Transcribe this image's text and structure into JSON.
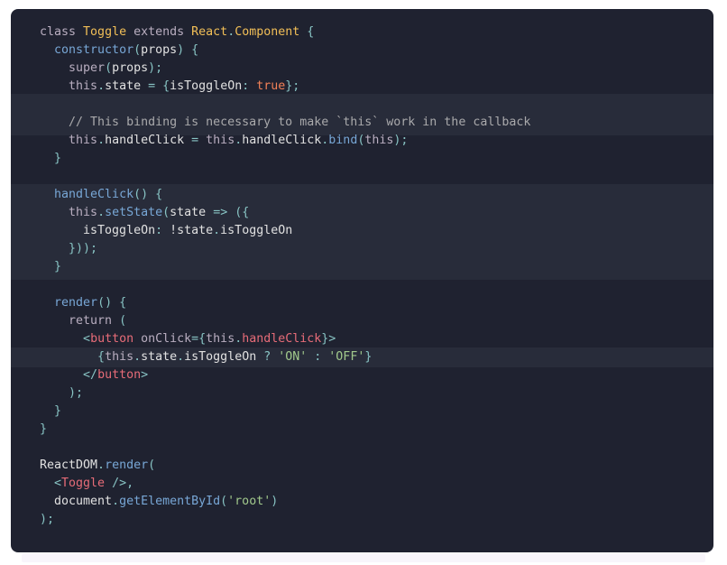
{
  "editor": {
    "highlight_band_1": [
      4,
      5
    ],
    "highlight_band_2": [
      9,
      13
    ],
    "highlight_line": 18,
    "lines": [
      [
        [
          "t-kw",
          "class "
        ],
        [
          "t-cls",
          "Toggle"
        ],
        [
          "t-kw",
          " extends "
        ],
        [
          "t-cls",
          "React"
        ],
        [
          "t-p",
          "."
        ],
        [
          "t-cls",
          "Component"
        ],
        [
          "t-p",
          " {"
        ]
      ],
      [
        [
          "t-txt",
          "  "
        ],
        [
          "t-fn",
          "constructor"
        ],
        [
          "t-p",
          "("
        ],
        [
          "t-txt",
          "props"
        ],
        [
          "t-p",
          ") {"
        ]
      ],
      [
        [
          "t-txt",
          "    "
        ],
        [
          "t-kw",
          "super"
        ],
        [
          "t-p",
          "("
        ],
        [
          "t-txt",
          "props"
        ],
        [
          "t-p",
          ");"
        ]
      ],
      [
        [
          "t-txt",
          "    "
        ],
        [
          "t-kw",
          "this"
        ],
        [
          "t-p",
          "."
        ],
        [
          "t-txt",
          "state "
        ],
        [
          "t-p",
          "= {"
        ],
        [
          "t-txt",
          "isToggleOn"
        ],
        [
          "t-p",
          ": "
        ],
        [
          "t-bool",
          "true"
        ],
        [
          "t-p",
          "};"
        ]
      ],
      [],
      [
        [
          "t-cmt",
          "    // This binding is necessary to make `this` work in the callback"
        ]
      ],
      [
        [
          "t-txt",
          "    "
        ],
        [
          "t-kw",
          "this"
        ],
        [
          "t-p",
          "."
        ],
        [
          "t-txt",
          "handleClick "
        ],
        [
          "t-p",
          "= "
        ],
        [
          "t-kw",
          "this"
        ],
        [
          "t-p",
          "."
        ],
        [
          "t-txt",
          "handleClick"
        ],
        [
          "t-p",
          "."
        ],
        [
          "t-fn",
          "bind"
        ],
        [
          "t-p",
          "("
        ],
        [
          "t-kw",
          "this"
        ],
        [
          "t-p",
          ");"
        ]
      ],
      [
        [
          "t-p",
          "  }"
        ]
      ],
      [],
      [
        [
          "t-txt",
          "  "
        ],
        [
          "t-fn",
          "handleClick"
        ],
        [
          "t-p",
          "() {"
        ]
      ],
      [
        [
          "t-txt",
          "    "
        ],
        [
          "t-kw",
          "this"
        ],
        [
          "t-p",
          "."
        ],
        [
          "t-fn",
          "setState"
        ],
        [
          "t-p",
          "("
        ],
        [
          "t-txt",
          "state "
        ],
        [
          "t-p",
          "=> ({"
        ]
      ],
      [
        [
          "t-txt",
          "      isToggleOn"
        ],
        [
          "t-p",
          ": "
        ],
        [
          "t-txt",
          "!state"
        ],
        [
          "t-p",
          "."
        ],
        [
          "t-txt",
          "isToggleOn"
        ]
      ],
      [
        [
          "t-p",
          "    }));"
        ]
      ],
      [
        [
          "t-p",
          "  }"
        ]
      ],
      [],
      [
        [
          "t-txt",
          "  "
        ],
        [
          "t-fn",
          "render"
        ],
        [
          "t-p",
          "() {"
        ]
      ],
      [
        [
          "t-txt",
          "    "
        ],
        [
          "t-kw",
          "return"
        ],
        [
          "t-p",
          " ("
        ]
      ],
      [
        [
          "t-txt",
          "      "
        ],
        [
          "t-p",
          "<"
        ],
        [
          "t-prop",
          "button "
        ],
        [
          "t-var",
          "onClick"
        ],
        [
          "t-p",
          "={"
        ],
        [
          "t-kw",
          "this"
        ],
        [
          "t-p",
          "."
        ],
        [
          "t-prop",
          "handleClick"
        ],
        [
          "t-p",
          "}>"
        ]
      ],
      [
        [
          "t-txt",
          "        "
        ],
        [
          "t-p",
          "{"
        ],
        [
          "t-kw",
          "this"
        ],
        [
          "t-p",
          "."
        ],
        [
          "t-txt",
          "state"
        ],
        [
          "t-p",
          "."
        ],
        [
          "t-txt",
          "isToggleOn "
        ],
        [
          "t-p",
          "? "
        ],
        [
          "t-str",
          "'ON'"
        ],
        [
          "t-p",
          " : "
        ],
        [
          "t-str",
          "'OFF'"
        ],
        [
          "t-p",
          "}"
        ]
      ],
      [
        [
          "t-txt",
          "      "
        ],
        [
          "t-p",
          "</"
        ],
        [
          "t-prop",
          "button"
        ],
        [
          "t-p",
          ">"
        ]
      ],
      [
        [
          "t-p",
          "    );"
        ]
      ],
      [
        [
          "t-p",
          "  }"
        ]
      ],
      [
        [
          "t-p",
          "}"
        ]
      ],
      [],
      [
        [
          "t-txt",
          "ReactDOM"
        ],
        [
          "t-p",
          "."
        ],
        [
          "t-fn",
          "render"
        ],
        [
          "t-p",
          "("
        ]
      ],
      [
        [
          "t-txt",
          "  "
        ],
        [
          "t-p",
          "<"
        ],
        [
          "t-prop",
          "Toggle "
        ],
        [
          "t-p",
          "/>,"
        ]
      ],
      [
        [
          "t-txt",
          "  document"
        ],
        [
          "t-p",
          "."
        ],
        [
          "t-fn",
          "getElementById"
        ],
        [
          "t-p",
          "("
        ],
        [
          "t-str",
          "'root'"
        ],
        [
          "t-p",
          ")"
        ]
      ],
      [
        [
          "t-p",
          ");"
        ]
      ]
    ]
  }
}
